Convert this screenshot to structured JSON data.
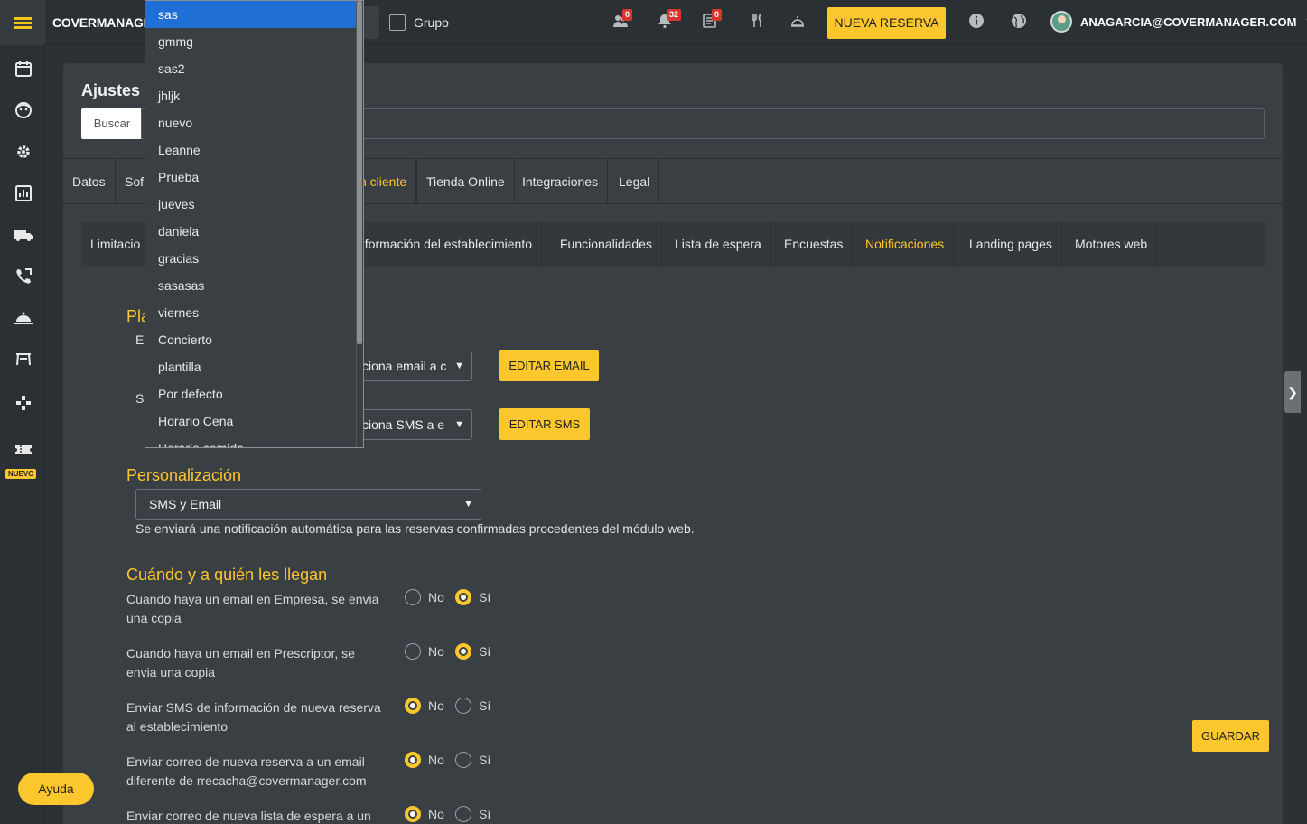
{
  "topbar": {
    "brand": "COVERMANAGER",
    "grupo_label": "Grupo",
    "badges": {
      "clients": "0",
      "notifications": "32",
      "list": "0"
    },
    "nueva_reserva": "NUEVA RESERVA",
    "user": "ANAGARCIA@COVERMANAGER.COM"
  },
  "sidebar": {
    "nuevo": "NUEVO"
  },
  "page": {
    "title": "Ajustes d",
    "buscar": "Buscar",
    "tabs1": [
      "Datos",
      "Sof",
      "n cliente",
      "Tienda Online",
      "Integraciones",
      "Legal"
    ],
    "tabs2": [
      "Limitacio",
      "nformación del establecimiento",
      "Funcionalidades",
      "Lista de espera",
      "Encuestas",
      "Notificaciones",
      "Landing pages",
      "Motores web"
    ]
  },
  "plantillas": {
    "title_frag": "Pla",
    "email_label_frag": "E",
    "sms_label_frag": "S",
    "email_select": "ciona email a c",
    "sms_select": "ciona SMS a e",
    "edit_email": "EDITAR EMAIL",
    "edit_sms": "EDITAR SMS"
  },
  "personalizacion": {
    "title": "Personalización",
    "select_value": "SMS y Email",
    "note": "Se enviará una notificación automática para las reservas confirmadas procedentes del módulo web."
  },
  "cuando": {
    "title": "Cuándo y a quién les llegan",
    "no": "No",
    "si": "Sí",
    "rows": [
      {
        "text": "Cuando haya un email en Empresa, se envia una copia",
        "value": "si"
      },
      {
        "text": "Cuando haya un email en Prescriptor, se envia una copia",
        "value": "si"
      },
      {
        "text": "Enviar SMS de información de nueva reserva al establecimiento",
        "value": "no"
      },
      {
        "text": "Enviar correo de nueva reserva a un email diferente de rrecacha@covermanager.com",
        "value": "no"
      },
      {
        "text": "Enviar correo de nueva lista de espera a un",
        "value": "no"
      }
    ]
  },
  "guardar": "GUARDAR",
  "ayuda": "Ayuda",
  "dropdown": {
    "items": [
      "sas",
      "gmmg",
      "sas2",
      "jhljk",
      "nuevo",
      "Leanne",
      "Prueba",
      "jueves",
      "daniela",
      "gracias",
      "sasasas",
      "viernes",
      "Concierto",
      "plantilla",
      "Por defecto",
      "Horario Cena",
      "Horario comida"
    ],
    "highlighted": "sas"
  }
}
